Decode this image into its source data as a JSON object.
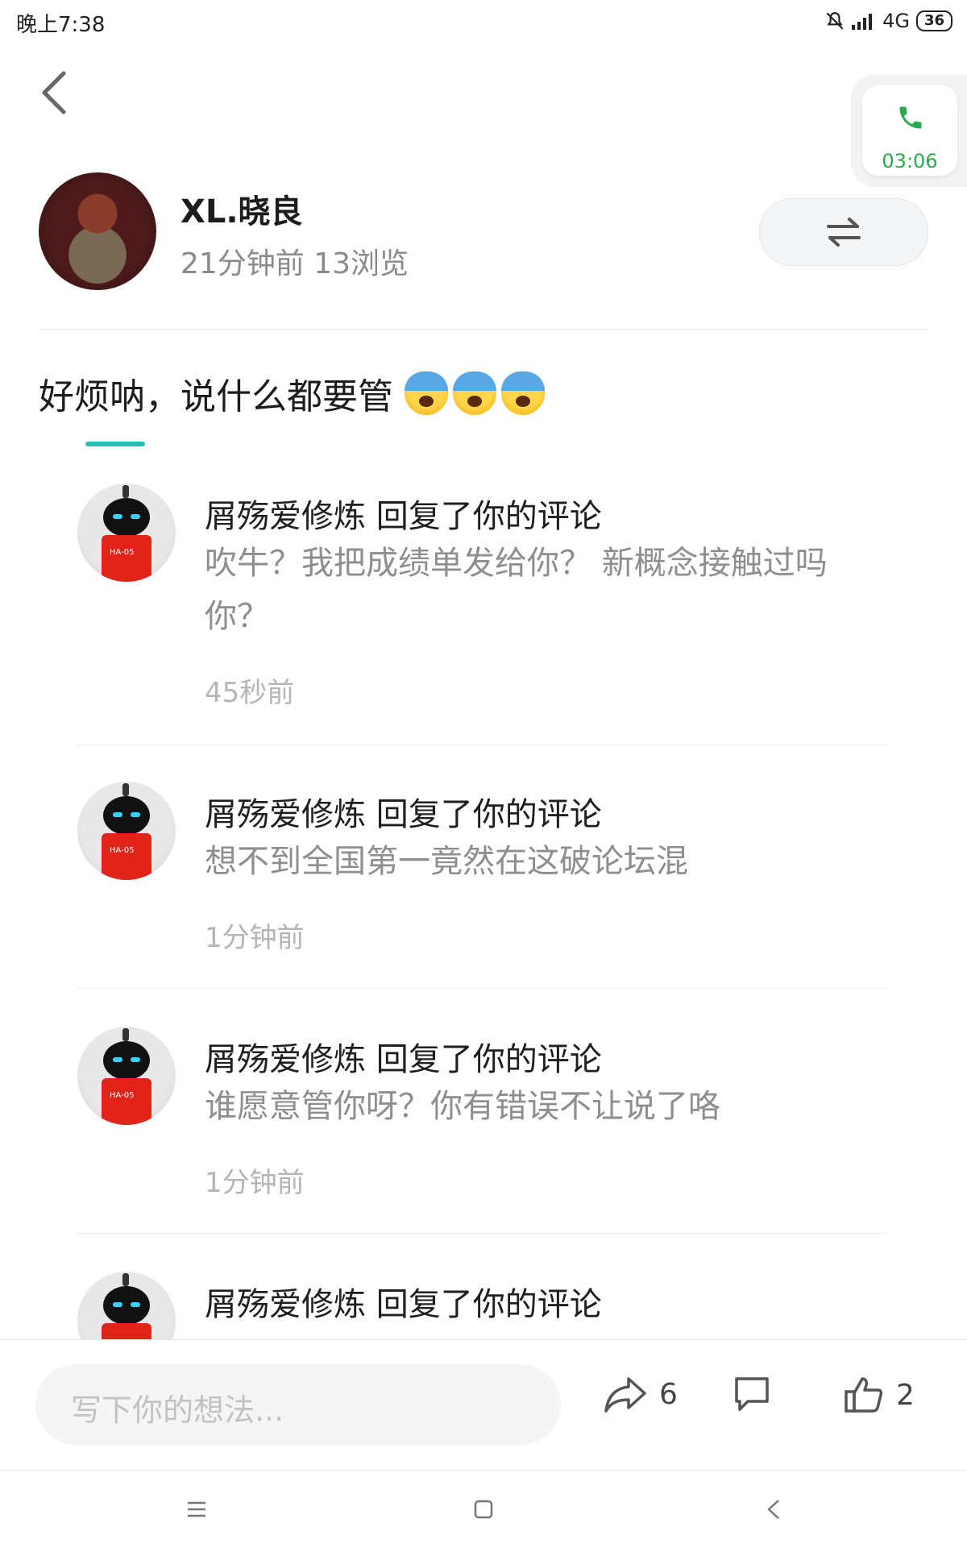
{
  "status_bar": {
    "time": "晚上7:38",
    "network": "4G",
    "battery": "36"
  },
  "call": {
    "timer": "03:06",
    "icon": "phone-icon",
    "color": "#2aa94f"
  },
  "post": {
    "author": "XL.晓良",
    "meta": "21分钟前  13浏览",
    "title": "好烦呐，说什么都要管",
    "emoji_icon": "anxious-sweat-emoji"
  },
  "comments": [
    {
      "title": "屑殇爱修炼 回复了你的评论",
      "body": "吹牛？我把成绩单发给你？ 新概念接触过吗你？",
      "time": "45秒前",
      "avatar_label": "HA-05"
    },
    {
      "title": "屑殇爱修炼 回复了你的评论",
      "body": "想不到全国第一竟然在这破论坛混",
      "time": "1分钟前",
      "avatar_label": "HA-05"
    },
    {
      "title": "屑殇爱修炼 回复了你的评论",
      "body": "谁愿意管你呀？你有错误不让说了咯",
      "time": "1分钟前",
      "avatar_label": "HA-05"
    },
    {
      "title": "屑殇爱修炼 回复了你的评论",
      "body": "",
      "time": "",
      "avatar_label": ""
    }
  ],
  "bottom_bar": {
    "input_placeholder": "写下你的想法...",
    "share_count": "6",
    "like_count": "2"
  },
  "colors": {
    "accent": "#26c0b5",
    "call_green": "#2aa94f"
  }
}
